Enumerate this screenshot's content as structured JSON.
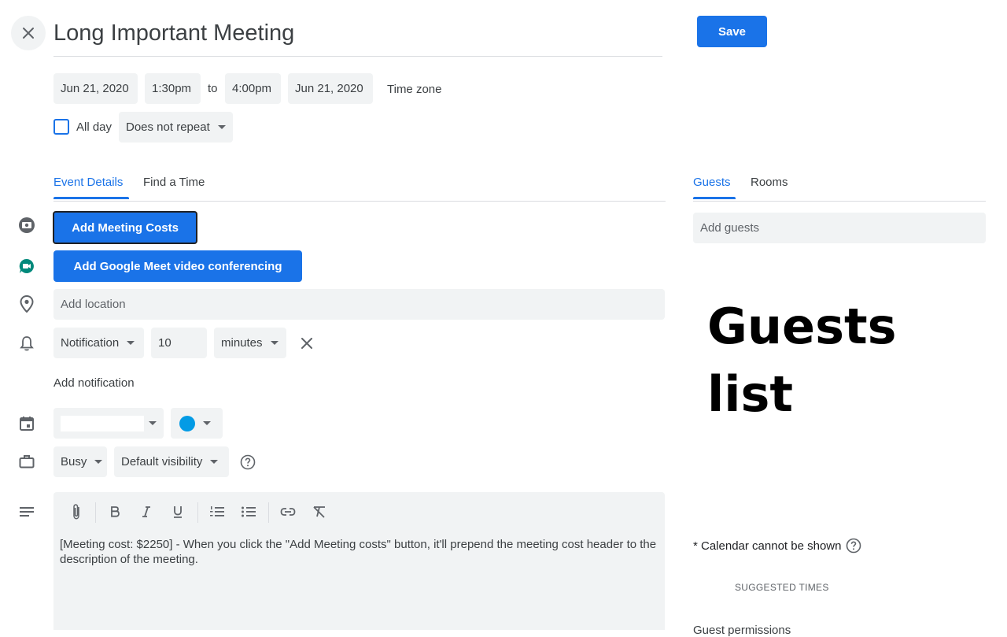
{
  "header": {
    "title": "Long Important Meeting",
    "save_label": "Save"
  },
  "datetime": {
    "start_date": "Jun 21, 2020",
    "start_time": "1:30pm",
    "to_label": "to",
    "end_time": "4:00pm",
    "end_date": "Jun 21, 2020",
    "timezone_label": "Time zone",
    "all_day_label": "All day",
    "repeat_value": "Does not repeat"
  },
  "tabs": {
    "event_details": "Event Details",
    "find_a_time": "Find a Time",
    "guests": "Guests",
    "rooms": "Rooms"
  },
  "details": {
    "meeting_costs_button": "Add Meeting Costs",
    "meet_button": "Add Google Meet video conferencing",
    "location_placeholder": "Add location",
    "notification_type": "Notification",
    "notification_value": "10",
    "notification_unit": "minutes",
    "add_notification": "Add notification",
    "calendar_value": "",
    "busy_value": "Busy",
    "visibility_value": "Default visibility",
    "description": "[Meeting cost: $2250] - When you click the \"Add Meeting costs\" button, it'll prepend the meeting cost header to the description of the meeting."
  },
  "guests_panel": {
    "add_guests_placeholder": "Add guests",
    "list_heading": "Guests list",
    "calendar_note": "* Calendar cannot be shown",
    "suggested_times": "SUGGESTED TIMES",
    "guest_permissions": "Guest permissions"
  },
  "colors": {
    "accent": "#1a73e8",
    "event_color": "#039be5",
    "meet_green": "#00897b",
    "field_bg": "#f1f3f4"
  },
  "icons": [
    "close-icon",
    "meeting-cost-icon",
    "google-meet-icon",
    "location-pin-icon",
    "bell-icon",
    "clear-notification-icon",
    "calendar-icon",
    "briefcase-icon",
    "help-icon",
    "description-icon",
    "attach-icon",
    "bold-icon",
    "italic-icon",
    "underline-icon",
    "numbered-list-icon",
    "bulleted-list-icon",
    "link-icon",
    "clear-formatting-icon"
  ]
}
